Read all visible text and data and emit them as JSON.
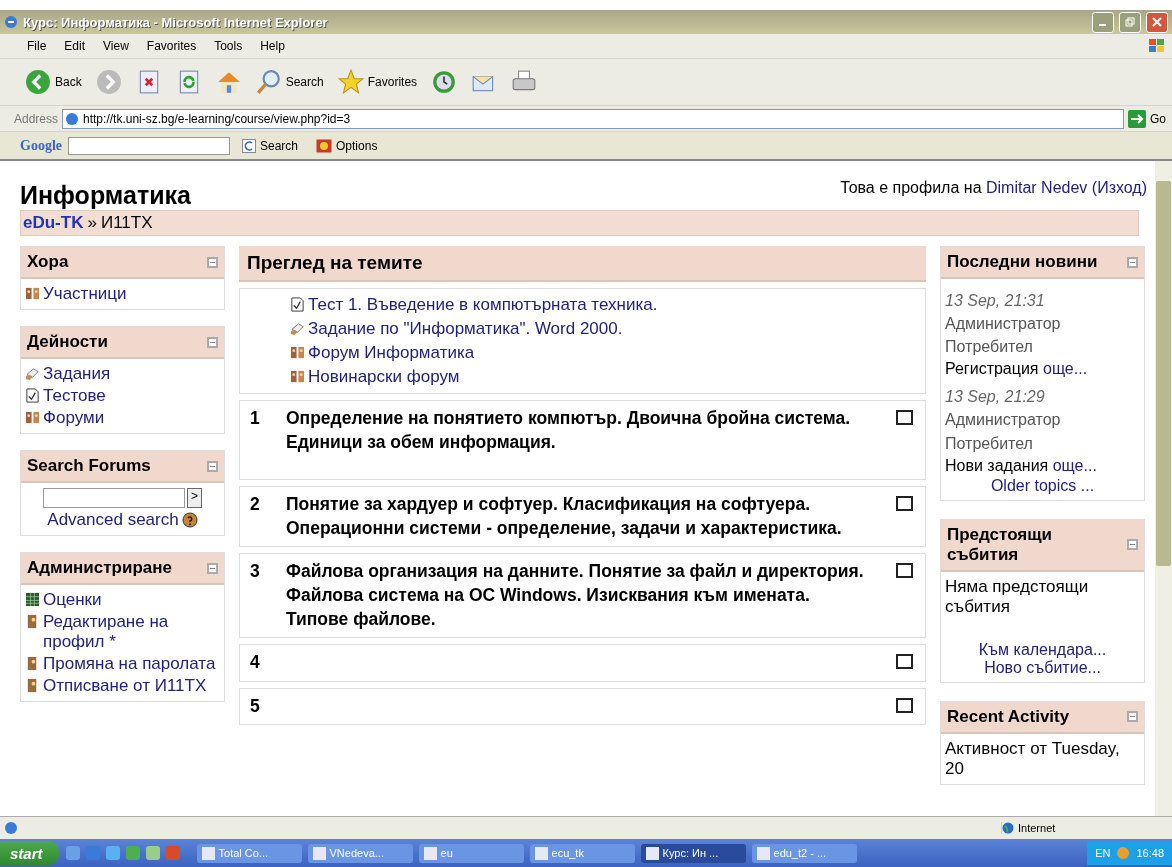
{
  "window": {
    "title": "Курс: Информатика - Microsoft Internet Explorer"
  },
  "menu": [
    "File",
    "Edit",
    "View",
    "Favorites",
    "Tools",
    "Help"
  ],
  "toolbar": [
    {
      "kind": "back",
      "label": "Back"
    },
    {
      "kind": "forward"
    },
    {
      "kind": "stop"
    },
    {
      "kind": "refresh"
    },
    {
      "kind": "home"
    },
    {
      "kind": "search",
      "label": "Search"
    },
    {
      "kind": "favorites",
      "label": "Favorites"
    },
    {
      "kind": "history"
    },
    {
      "kind": "mail"
    },
    {
      "kind": "print"
    }
  ],
  "address": {
    "label": "Address",
    "url": "http://tk.uni-sz.bg/e-learning/course/view.php?id=3",
    "go": "Go"
  },
  "google": {
    "logo": "Google",
    "search": "Search",
    "options": "Options"
  },
  "page": {
    "title": "Информатика",
    "login": {
      "prefix": "Това е профила на",
      "user": "Dimitar Nedev",
      "logout": "(Изход)"
    },
    "breadcrumb": {
      "home": "eDu-TK",
      "separator": "»",
      "current": "И11ТХ"
    }
  },
  "left_blocks": [
    {
      "title": "Хора",
      "kind": "links",
      "items": [
        {
          "kind": "participants",
          "text": "Участници"
        }
      ]
    },
    {
      "title": "Дейности",
      "kind": "links",
      "items": [
        {
          "kind": "assignment",
          "text": "Задания"
        },
        {
          "kind": "quiz",
          "text": "Тестове"
        },
        {
          "kind": "forum",
          "text": "Форуми"
        }
      ]
    },
    {
      "title": "Search Forums",
      "kind": "search",
      "button": ">",
      "link": "Advanced search"
    },
    {
      "title": "Администриране",
      "kind": "links",
      "items": [
        {
          "kind": "grades",
          "text": "Оценки"
        },
        {
          "kind": "profile",
          "text": "Редактиране на профил *"
        },
        {
          "kind": "profile",
          "text": "Промяна на паролата"
        },
        {
          "kind": "profile",
          "text": "Отписване от И11ТХ"
        }
      ]
    }
  ],
  "center": {
    "title": "Преглед на темите",
    "intro": [
      {
        "kind": "quiz",
        "text": "Тест 1. Въведение в компютърната техника."
      },
      {
        "kind": "assignment",
        "text": "Задание по \"Информатика\". Word 2000."
      },
      {
        "kind": "forum",
        "text": "Форум Информатика"
      },
      {
        "kind": "forum",
        "text": "Новинарски форум"
      }
    ],
    "sections": [
      {
        "number": "1",
        "summary": "Определение на понятието компютър. Двоична бройна система. Единици за обем информация."
      },
      {
        "number": "2",
        "summary": "Понятие за хардуер и софтуер. Класификация на софтуера. Операционни системи - определение, задачи и характеристика."
      },
      {
        "number": "3",
        "summary": "Файлова организация на данните. Понятие за файл и директория. Файлова система на ОС Windows. Изисквания към имената. Типове файлове."
      },
      {
        "number": "4"
      },
      {
        "number": "5"
      }
    ]
  },
  "right_blocks": [
    {
      "title": "Последни новини",
      "kind": "news",
      "posts": [
        {
          "date": "13 Sep, 21:31",
          "author": "Администратор Потребител",
          "subject": "Регистрация",
          "more": "още..."
        },
        {
          "date": "13 Sep, 21:29",
          "author": "Администратор Потребител",
          "subject": "Нови задания",
          "more": "още..."
        }
      ],
      "links": [
        "Older topics ..."
      ]
    },
    {
      "title": "Предстоящи събития",
      "kind": "events",
      "text": "Няма предстоящи събития",
      "links": [
        "Към календара...",
        "Ново събитие..."
      ]
    },
    {
      "title": "Recent Activity",
      "kind": "activity",
      "text": "Активност от Tuesday, 20"
    }
  ],
  "status": {
    "zone": "Internet"
  },
  "taskbar": {
    "start": "start",
    "tasks": [
      {
        "label": "Total Co...",
        "selected": false
      },
      {
        "label": "VNedeva...",
        "selected": false
      },
      {
        "label": "eu",
        "selected": false
      },
      {
        "label": "ecu_tk",
        "selected": false
      },
      {
        "label": "Курс: Ин ...",
        "selected": true
      },
      {
        "label": "edu_t2 - ...",
        "selected": false
      }
    ],
    "lang": "EN",
    "clock": "16:48"
  }
}
